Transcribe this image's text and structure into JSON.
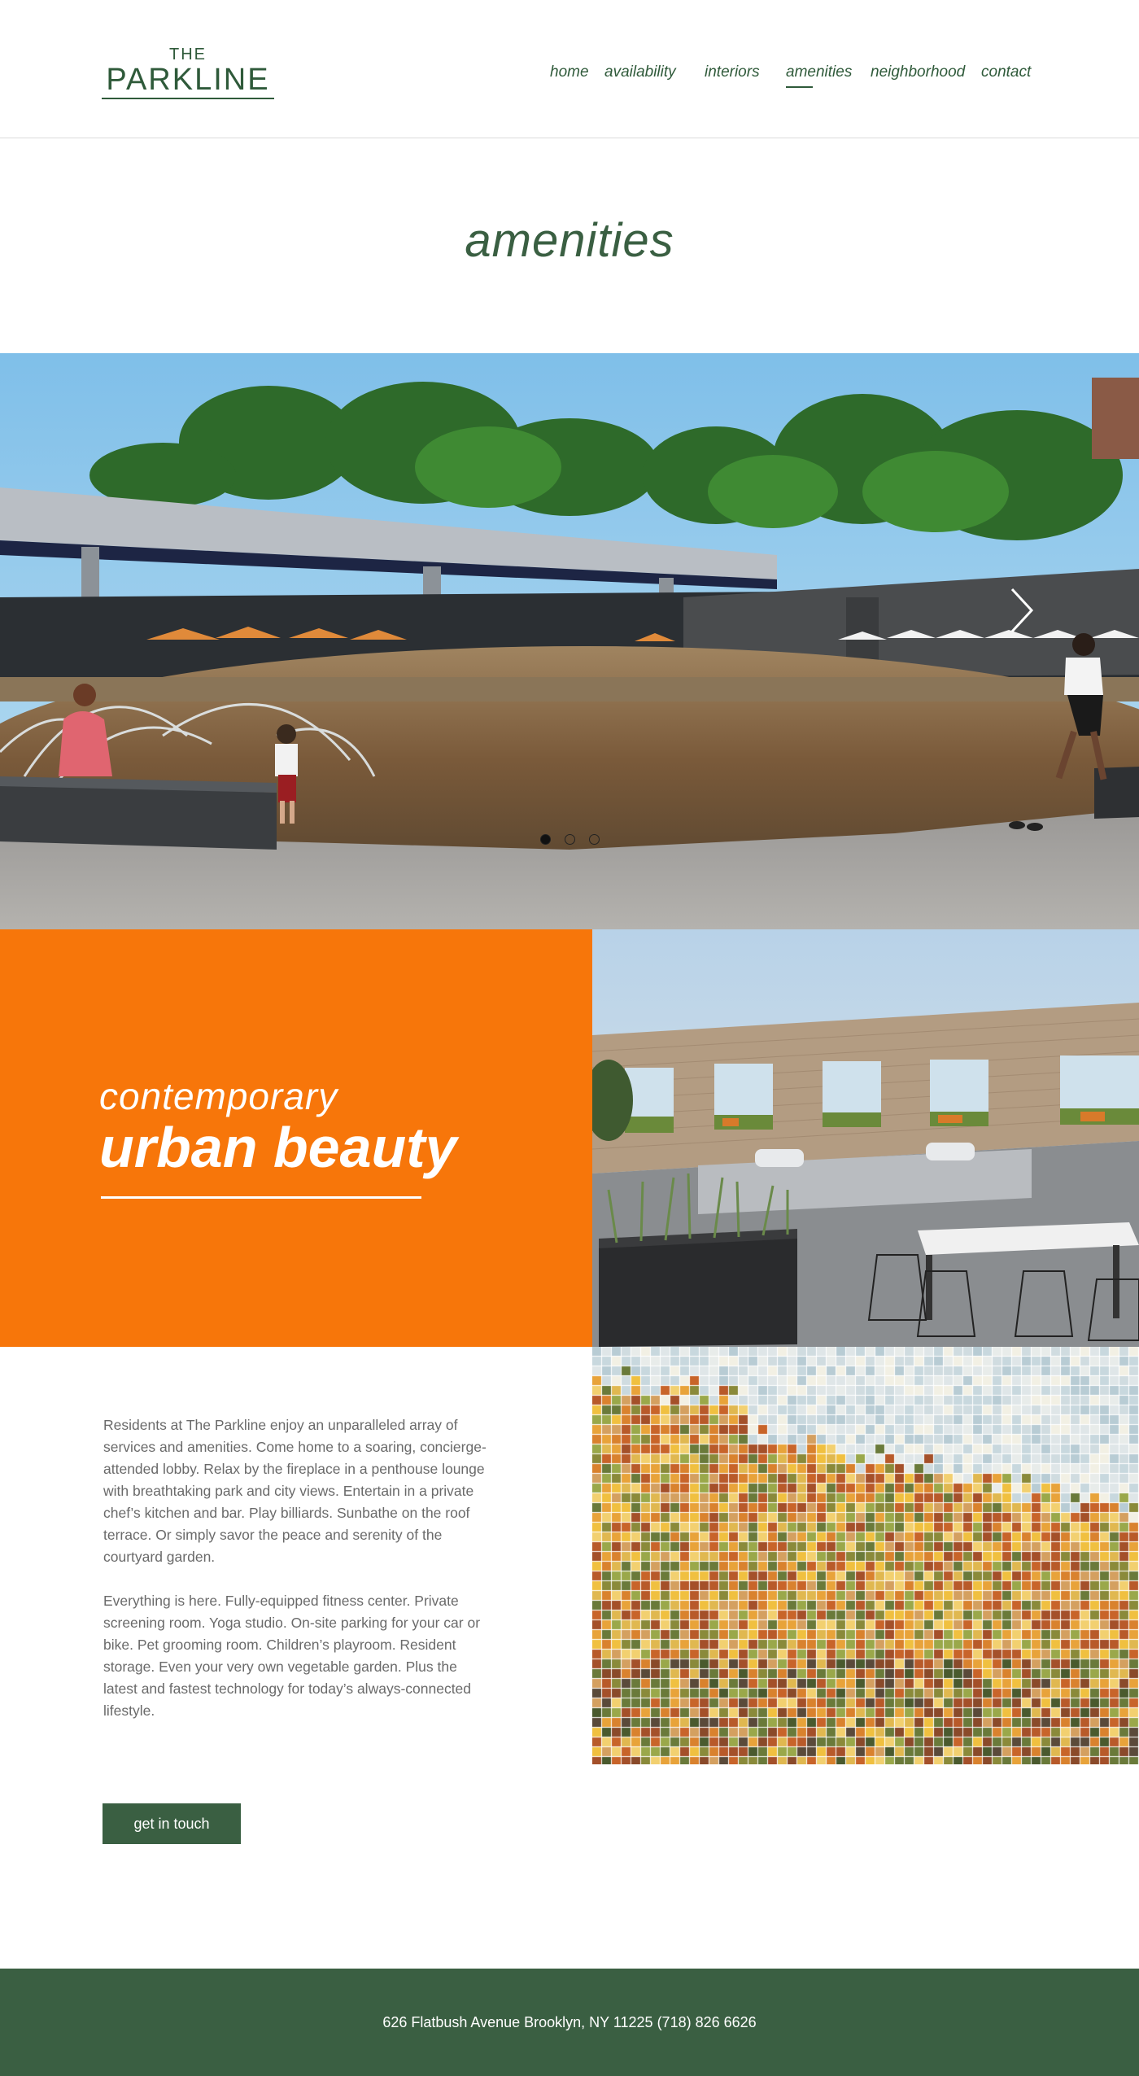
{
  "header": {
    "logo_top": "THE",
    "logo_main": "PARKLINE",
    "nav": [
      {
        "label": "home"
      },
      {
        "label": "availability"
      },
      {
        "label": "interiors"
      },
      {
        "label": "amenities",
        "active": true
      },
      {
        "label": "neighborhood"
      },
      {
        "label": "contact"
      }
    ]
  },
  "page_title": "amenities",
  "slider": {
    "current_slide": 1,
    "slide_count": 3
  },
  "feature": {
    "subtitle": "contemporary",
    "title": "urban beauty"
  },
  "body": {
    "paragraph_1": "Residents at The Parkline enjoy an unparalleled array of services and amenities. Come home to a soaring, concierge-attended lobby. Relax by the fireplace in a penthouse lounge with breathtaking park and city views. Entertain in a private chef’s kitchen and bar. Play billiards. Sunbathe on the roof terrace. Or simply savor the peace and serenity of the courtyard garden.",
    "paragraph_2": "Everything is here. Fully-equipped fitness center. Private screening room. Yoga studio. On-site parking for your car or bike. Pet grooming room. Children’s playroom. Resident storage. Even your very own vegetable garden. Plus the latest and fastest technology for today’s always-connected lifestyle."
  },
  "cta": {
    "label": "get in touch"
  },
  "footer": {
    "address": "626 Flatbush Avenue Brooklyn, NY 11225 (718) 826 6626"
  },
  "colors": {
    "brand_green": "#3a5f42",
    "accent_orange": "#f7760a",
    "footer_bg": "#3a5f42"
  }
}
